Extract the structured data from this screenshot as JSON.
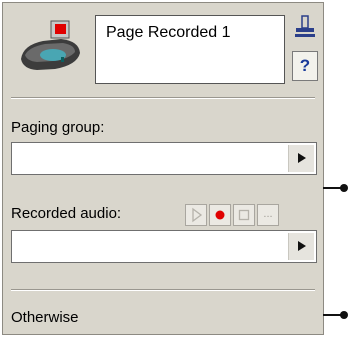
{
  "node": {
    "title": "Page Recorded 1",
    "help_label": "?",
    "paging_group_label": "Paging group:",
    "paging_group_value": "",
    "recorded_audio_label": "Recorded audio:",
    "recorded_audio_value": "",
    "otherwise_label": "Otherwise",
    "audio_buttons": [
      "play-icon",
      "record-icon",
      "stop-icon",
      "browse-icon"
    ],
    "browse_label": "...",
    "colors": {
      "panel": "#d9d6cc",
      "record": "#e00000"
    }
  }
}
